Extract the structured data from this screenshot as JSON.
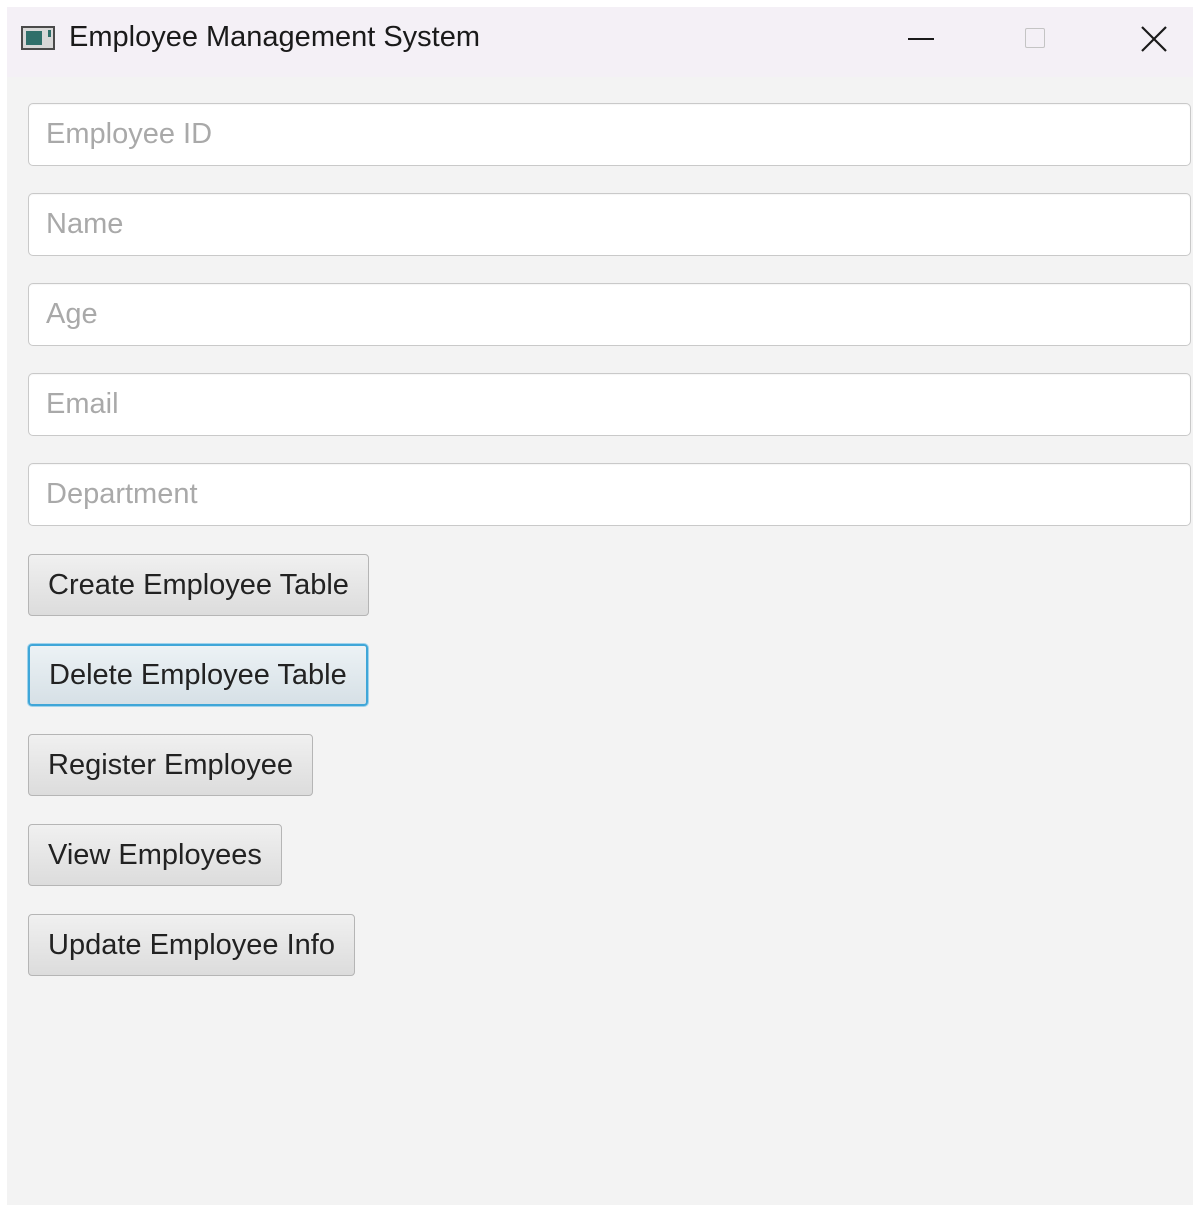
{
  "window": {
    "title": "Employee Management System",
    "icon": "java-app-icon",
    "controls": [
      "minimize-icon",
      "maximize-icon",
      "close-icon"
    ]
  },
  "form": {
    "fields": [
      {
        "name": "employee-id-field",
        "placeholder": "Employee ID",
        "value": ""
      },
      {
        "name": "name-field",
        "placeholder": "Name",
        "value": ""
      },
      {
        "name": "age-field",
        "placeholder": "Age",
        "value": ""
      },
      {
        "name": "email-field",
        "placeholder": "Email",
        "value": ""
      },
      {
        "name": "department-field",
        "placeholder": "Department",
        "value": ""
      }
    ]
  },
  "actions": {
    "create_table": "Create Employee Table",
    "delete_table": "Delete Employee Table",
    "register": "Register Employee",
    "view": "View Employees",
    "update": "Update Employee Info",
    "focused": "delete_table"
  },
  "colors": {
    "focus_ring": "#3fa6d8",
    "window_bg": "#f3f3f3",
    "titlebar_bg": "#f4f0f6"
  }
}
